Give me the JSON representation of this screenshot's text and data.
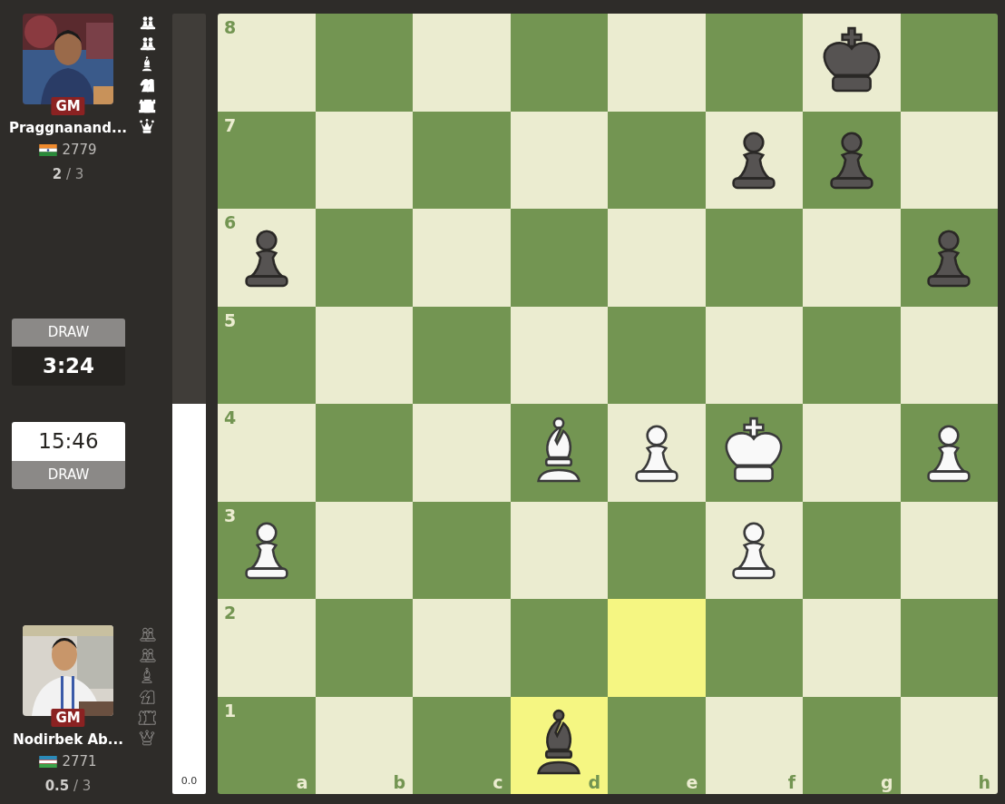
{
  "players": [
    {
      "title": "GM",
      "name": "Praggnanand...",
      "rating": "2779",
      "score": "**2** / 3",
      "captured": [
        {
          "kind": "pawn-pair",
          "filled": true
        },
        {
          "kind": "pawn-pair",
          "filled": true
        },
        {
          "kind": "bishop",
          "filled": true
        },
        {
          "kind": "knight-pair",
          "filled": true
        },
        {
          "kind": "rook-pair",
          "filled": true
        },
        {
          "kind": "queen",
          "filled": true
        }
      ]
    },
    {
      "title": "GM",
      "name": "Nodirbek Ab...",
      "rating": "2771",
      "score": "**0.5** / 3",
      "captured": [
        {
          "kind": "pawn-pair",
          "filled": false
        },
        {
          "kind": "pawn-pair",
          "filled": false
        },
        {
          "kind": "bishop",
          "filled": false
        },
        {
          "kind": "knight-pair",
          "filled": false
        },
        {
          "kind": "rook-pair",
          "filled": false
        },
        {
          "kind": "queen",
          "filled": false
        }
      ]
    }
  ],
  "clocks": [
    {
      "offer": "DRAW",
      "time": "3:24",
      "active": false
    },
    {
      "offer": "DRAW",
      "time": "15:46",
      "active": true
    }
  ],
  "eval_bar": {
    "level": 0.5,
    "reading": "0.0"
  },
  "board": {
    "file_labels": [
      "a",
      "b",
      "c",
      "d",
      "e",
      "f",
      "g",
      "h"
    ],
    "rows": [
      {
        "label": "8",
        "squares": [
          {
            "kind": "empty",
            "highlighted": false
          },
          {
            "kind": "empty",
            "highlighted": false
          },
          {
            "kind": "empty",
            "highlighted": false
          },
          {
            "kind": "empty",
            "highlighted": false
          },
          {
            "kind": "empty",
            "highlighted": false
          },
          {
            "kind": "empty",
            "highlighted": false
          },
          {
            "kind": "king",
            "white": false,
            "highlighted": false
          },
          {
            "kind": "empty",
            "highlighted": false
          }
        ]
      },
      {
        "label": "7",
        "squares": [
          {
            "kind": "empty",
            "highlighted": false
          },
          {
            "kind": "empty",
            "highlighted": false
          },
          {
            "kind": "empty",
            "highlighted": false
          },
          {
            "kind": "empty",
            "highlighted": false
          },
          {
            "kind": "empty",
            "highlighted": false
          },
          {
            "kind": "pawn",
            "white": false,
            "highlighted": false
          },
          {
            "kind": "pawn",
            "white": false,
            "highlighted": false
          },
          {
            "kind": "empty",
            "highlighted": false
          }
        ]
      },
      {
        "label": "6",
        "squares": [
          {
            "kind": "pawn",
            "white": false,
            "highlighted": false
          },
          {
            "kind": "empty",
            "highlighted": false
          },
          {
            "kind": "empty",
            "highlighted": false
          },
          {
            "kind": "empty",
            "highlighted": false
          },
          {
            "kind": "empty",
            "highlighted": false
          },
          {
            "kind": "empty",
            "highlighted": false
          },
          {
            "kind": "empty",
            "highlighted": false
          },
          {
            "kind": "pawn",
            "white": false,
            "highlighted": false
          }
        ]
      },
      {
        "label": "5",
        "squares": [
          {
            "kind": "empty",
            "highlighted": false
          },
          {
            "kind": "empty",
            "highlighted": false
          },
          {
            "kind": "empty",
            "highlighted": false
          },
          {
            "kind": "empty",
            "highlighted": false
          },
          {
            "kind": "empty",
            "highlighted": false
          },
          {
            "kind": "empty",
            "highlighted": false
          },
          {
            "kind": "empty",
            "highlighted": false
          },
          {
            "kind": "empty",
            "highlighted": false
          }
        ]
      },
      {
        "label": "4",
        "squares": [
          {
            "kind": "empty",
            "highlighted": false
          },
          {
            "kind": "empty",
            "highlighted": false
          },
          {
            "kind": "empty",
            "highlighted": false
          },
          {
            "kind": "bishop",
            "white": true,
            "highlighted": false
          },
          {
            "kind": "pawn",
            "white": true,
            "highlighted": false
          },
          {
            "kind": "king",
            "white": true,
            "highlighted": false
          },
          {
            "kind": "empty",
            "highlighted": false
          },
          {
            "kind": "pawn",
            "white": true,
            "highlighted": false
          }
        ]
      },
      {
        "label": "3",
        "squares": [
          {
            "kind": "pawn",
            "white": true,
            "highlighted": false
          },
          {
            "kind": "empty",
            "highlighted": false
          },
          {
            "kind": "empty",
            "highlighted": false
          },
          {
            "kind": "empty",
            "highlighted": false
          },
          {
            "kind": "empty",
            "highlighted": false
          },
          {
            "kind": "pawn",
            "white": true,
            "highlighted": false
          },
          {
            "kind": "empty",
            "highlighted": false
          },
          {
            "kind": "empty",
            "highlighted": false
          }
        ]
      },
      {
        "label": "2",
        "squares": [
          {
            "kind": "empty",
            "highlighted": false
          },
          {
            "kind": "empty",
            "highlighted": false
          },
          {
            "kind": "empty",
            "highlighted": false
          },
          {
            "kind": "empty",
            "highlighted": false
          },
          {
            "kind": "empty",
            "highlighted": true
          },
          {
            "kind": "empty",
            "highlighted": false
          },
          {
            "kind": "empty",
            "highlighted": false
          },
          {
            "kind": "empty",
            "highlighted": false
          }
        ]
      },
      {
        "label": "1",
        "squares": [
          {
            "kind": "empty",
            "highlighted": false
          },
          {
            "kind": "empty",
            "highlighted": false
          },
          {
            "kind": "empty",
            "highlighted": false
          },
          {
            "kind": "bishop",
            "white": false,
            "highlighted": true
          },
          {
            "kind": "empty",
            "highlighted": false
          },
          {
            "kind": "empty",
            "highlighted": false
          },
          {
            "kind": "empty",
            "highlighted": false
          },
          {
            "kind": "empty",
            "highlighted": false
          }
        ]
      }
    ]
  }
}
